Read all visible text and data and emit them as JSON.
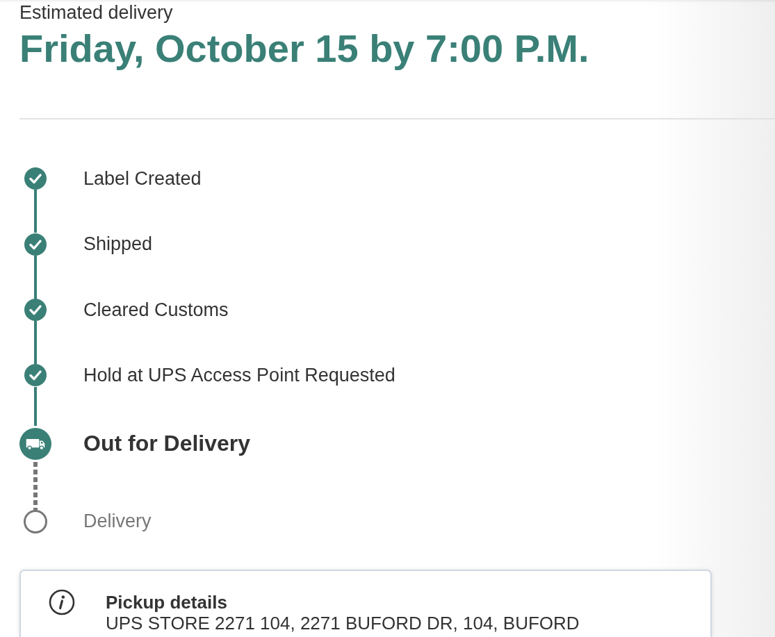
{
  "estimated_delivery": {
    "label": "Estimated delivery",
    "date": "Friday, October 15 by 7:00 P.M."
  },
  "progress_steps": [
    {
      "label": "Label Created",
      "kind": "completed"
    },
    {
      "label": "Shipped",
      "kind": "completed"
    },
    {
      "label": "Cleared Customs",
      "kind": "completed"
    },
    {
      "label": "Hold at UPS Access Point Requested",
      "kind": "completed"
    },
    {
      "label": "Out for Delivery",
      "kind": "current"
    },
    {
      "label": "Delivery",
      "kind": "pending"
    }
  ],
  "pickup_details": {
    "title": "Pickup details",
    "address": "UPS STORE 2271 104, 2271 BUFORD DR, 104, BUFORD"
  }
}
